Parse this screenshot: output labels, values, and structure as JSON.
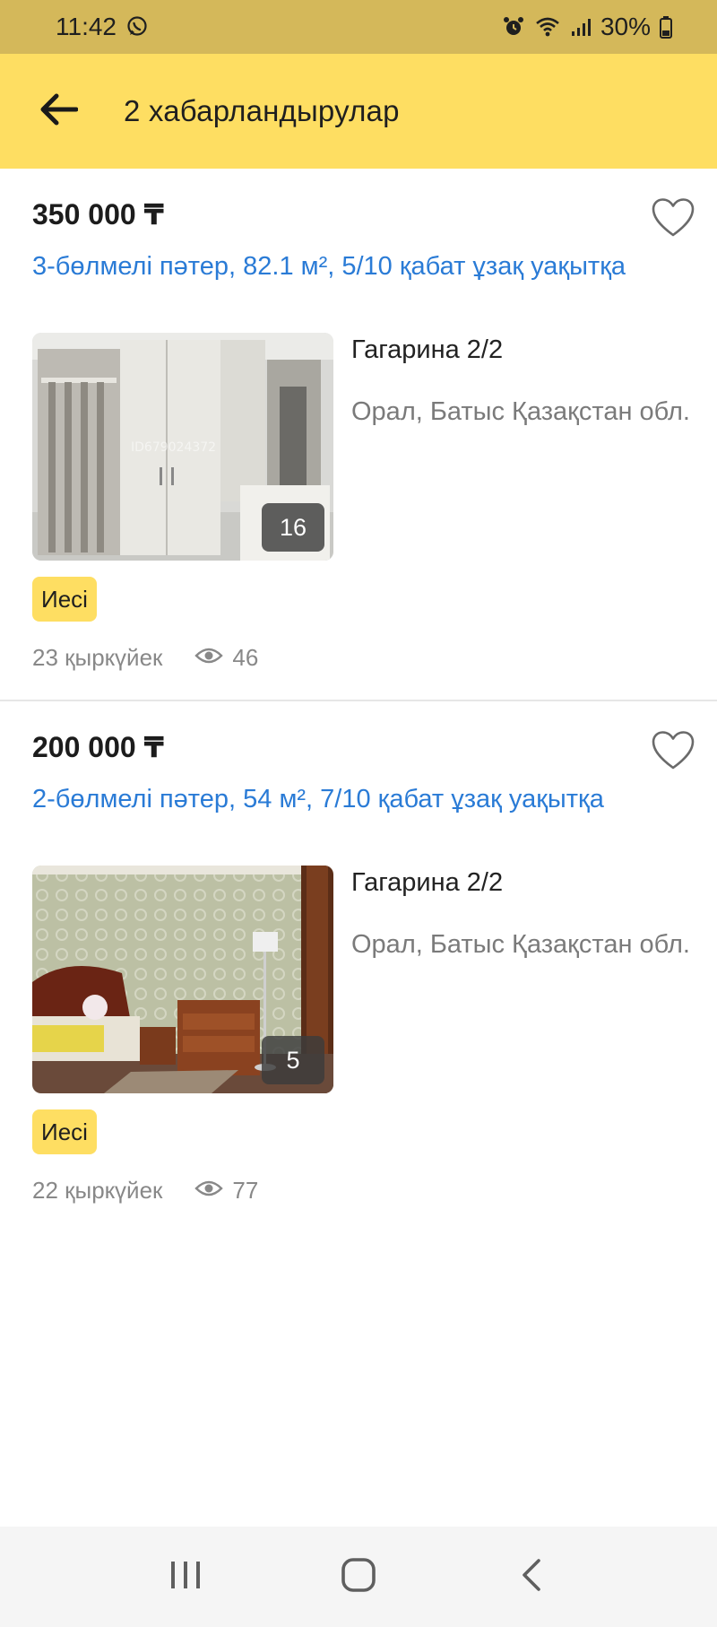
{
  "status_bar": {
    "time": "11:42",
    "battery": "30%",
    "icons": [
      "whatsapp-icon",
      "alarm-icon",
      "wifi-icon",
      "signal-icon",
      "battery-icon"
    ]
  },
  "header": {
    "title": "2 хабарландырулар",
    "back_icon": "arrow-left-icon"
  },
  "listings": [
    {
      "price": "350 000 ₸",
      "title": "3-бөлмелі пәтер, 82.1 м², 5/10 қабат ұзақ уақытқа",
      "photo_count": "16",
      "photo_watermark": "ID679024372",
      "address": "Гагарина 2/2",
      "city": "Орал, Батыс Қазақстан обл.",
      "badge": "Иесі",
      "date": "23 қыркүйек",
      "views": "46"
    },
    {
      "price": "200 000 ₸",
      "title": "2-бөлмелі пәтер, 54 м², 7/10 қабат ұзақ уақытқа",
      "photo_count": "5",
      "address": "Гагарина 2/2",
      "city": "Орал, Батыс Қазақстан обл.",
      "badge": "Иесі",
      "date": "22 қыркүйек",
      "views": "77"
    }
  ],
  "nav_bar": {
    "buttons": [
      "recent-apps-icon",
      "home-icon",
      "back-icon"
    ]
  },
  "colors": {
    "status_bar": "#d4b85a",
    "header": "#fede62",
    "link": "#2a7bd6",
    "badge": "#fede62"
  }
}
